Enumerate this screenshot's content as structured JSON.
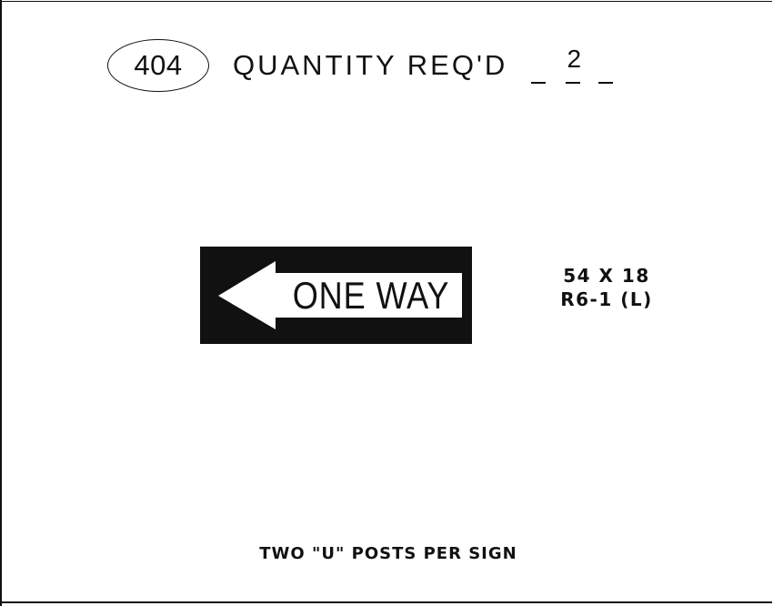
{
  "sheet": {
    "item_number": "404",
    "quantity_label": "QUANTITY REQ'D",
    "quantity_value": "2"
  },
  "sign": {
    "legend": "ONE WAY",
    "arrow_direction": "left",
    "icon": "left-arrow-icon",
    "colors": {
      "background": "#111111",
      "legend_panel": "#ffffff"
    }
  },
  "spec": {
    "size": "54 X 18",
    "code": "R6-1 (L)"
  },
  "footer": {
    "note": "TWO \"U\" POSTS PER SIGN"
  }
}
